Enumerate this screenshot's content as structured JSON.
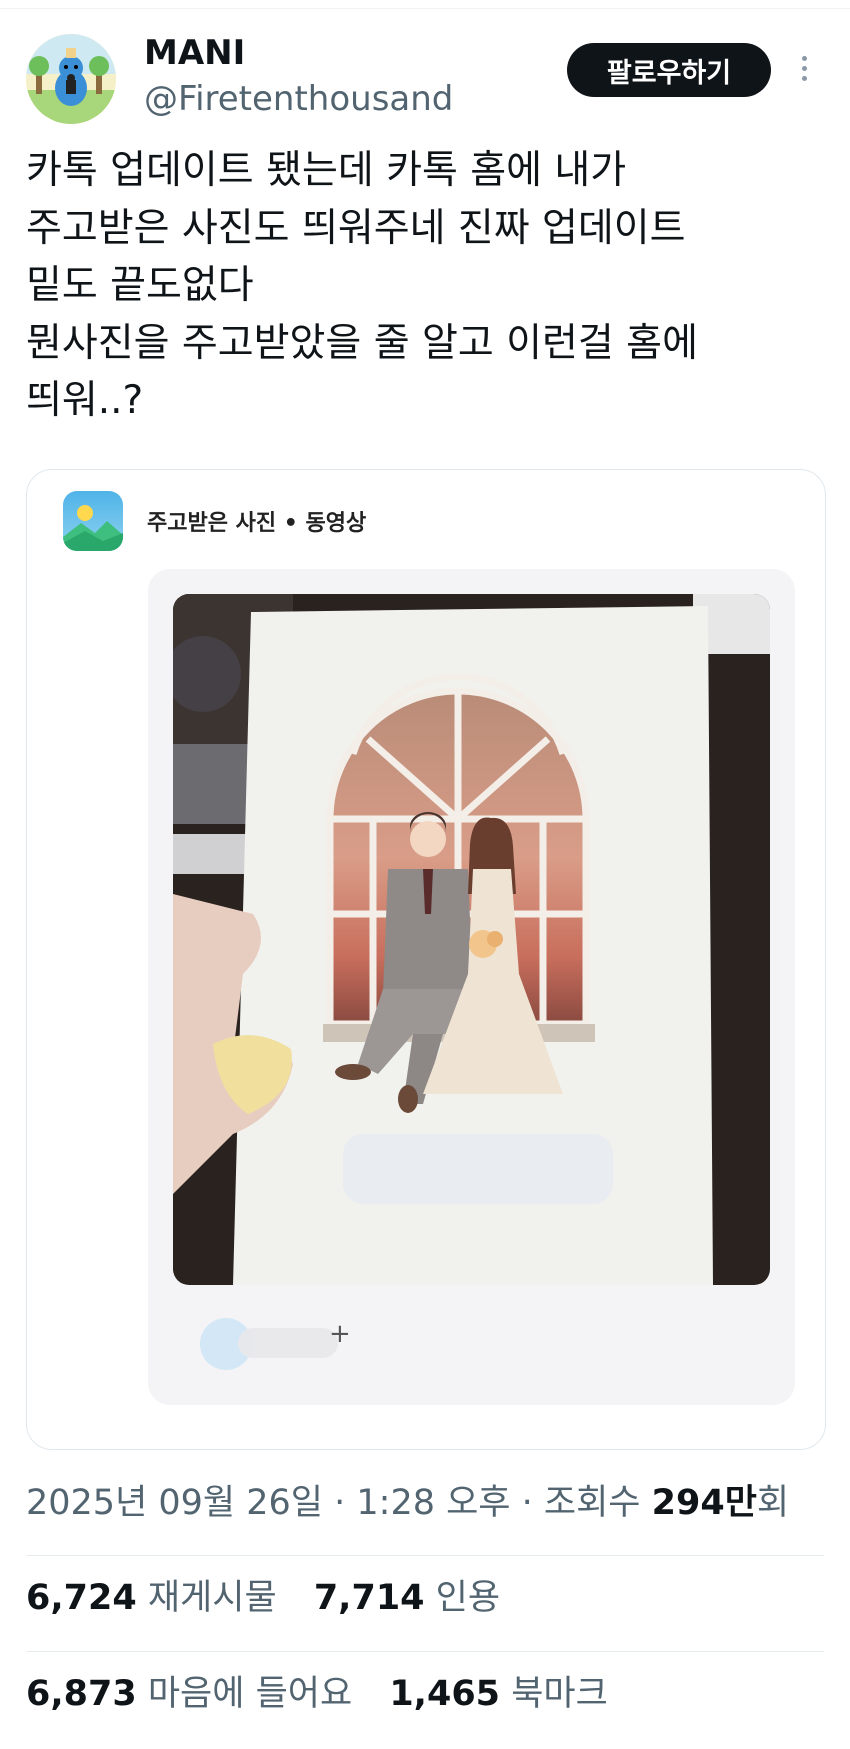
{
  "author": {
    "name": "MANI",
    "handle": "@Firetenthousand",
    "follow_label": "팔로우하기"
  },
  "tweet": {
    "lines": [
      "카톡 업데이트 됐는데 카톡 홈에 내가",
      "주고받은 사진도 띄워주네 진짜 업데이트",
      "밑도 끝도없다",
      "뭔사진을 주고받았을 줄 알고 이런걸 홈에",
      "띄워..?"
    ]
  },
  "card": {
    "title": "주고받은 사진 • 동영상",
    "plus": "+"
  },
  "meta": {
    "date": "2025년 09월 26일",
    "dot1": " · ",
    "time": "1:28 오후",
    "dot2": " · ",
    "views_label": "조회수 ",
    "views_value": "294만",
    "views_suffix": "회"
  },
  "stats": {
    "reposts": {
      "count": "6,724",
      "label": "재게시물"
    },
    "quotes": {
      "count": "7,714",
      "label": "인용"
    },
    "likes": {
      "count": "6,873",
      "label": "마음에 들어요"
    },
    "bookmarks": {
      "count": "1,465",
      "label": "북마크"
    }
  },
  "colors": {
    "text": "#0f1419",
    "secondary": "#536471",
    "follow_bg": "#0f1419",
    "divider": "#e6ebee"
  },
  "icons": {
    "more": "more-vertical-icon",
    "app": "photo-gallery-icon"
  }
}
